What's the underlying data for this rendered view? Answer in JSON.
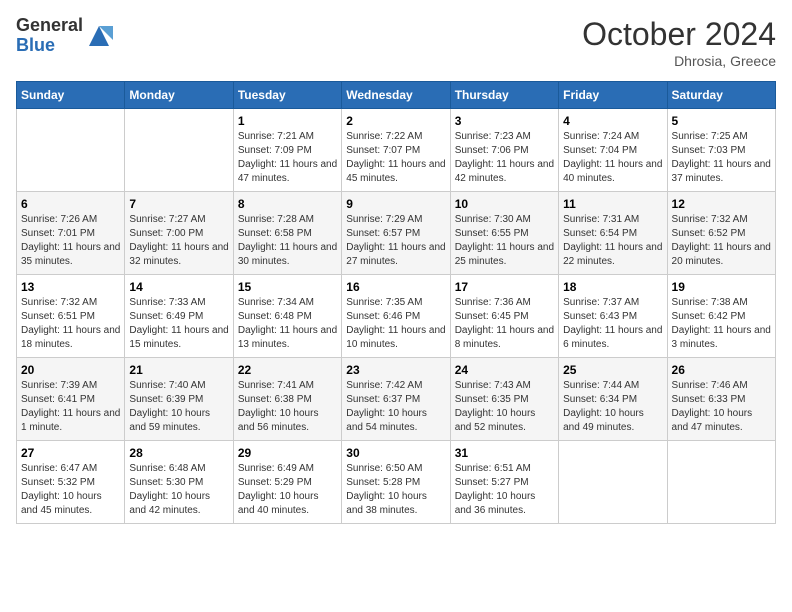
{
  "logo": {
    "general": "General",
    "blue": "Blue"
  },
  "title": "October 2024",
  "location": "Dhrosia, Greece",
  "days_of_week": [
    "Sunday",
    "Monday",
    "Tuesday",
    "Wednesday",
    "Thursday",
    "Friday",
    "Saturday"
  ],
  "weeks": [
    [
      {
        "day": null
      },
      {
        "day": null
      },
      {
        "day": "1",
        "sunrise": "7:21 AM",
        "sunset": "7:09 PM",
        "daylight": "11 hours and 47 minutes."
      },
      {
        "day": "2",
        "sunrise": "7:22 AM",
        "sunset": "7:07 PM",
        "daylight": "11 hours and 45 minutes."
      },
      {
        "day": "3",
        "sunrise": "7:23 AM",
        "sunset": "7:06 PM",
        "daylight": "11 hours and 42 minutes."
      },
      {
        "day": "4",
        "sunrise": "7:24 AM",
        "sunset": "7:04 PM",
        "daylight": "11 hours and 40 minutes."
      },
      {
        "day": "5",
        "sunrise": "7:25 AM",
        "sunset": "7:03 PM",
        "daylight": "11 hours and 37 minutes."
      }
    ],
    [
      {
        "day": "6",
        "sunrise": "7:26 AM",
        "sunset": "7:01 PM",
        "daylight": "11 hours and 35 minutes."
      },
      {
        "day": "7",
        "sunrise": "7:27 AM",
        "sunset": "7:00 PM",
        "daylight": "11 hours and 32 minutes."
      },
      {
        "day": "8",
        "sunrise": "7:28 AM",
        "sunset": "6:58 PM",
        "daylight": "11 hours and 30 minutes."
      },
      {
        "day": "9",
        "sunrise": "7:29 AM",
        "sunset": "6:57 PM",
        "daylight": "11 hours and 27 minutes."
      },
      {
        "day": "10",
        "sunrise": "7:30 AM",
        "sunset": "6:55 PM",
        "daylight": "11 hours and 25 minutes."
      },
      {
        "day": "11",
        "sunrise": "7:31 AM",
        "sunset": "6:54 PM",
        "daylight": "11 hours and 22 minutes."
      },
      {
        "day": "12",
        "sunrise": "7:32 AM",
        "sunset": "6:52 PM",
        "daylight": "11 hours and 20 minutes."
      }
    ],
    [
      {
        "day": "13",
        "sunrise": "7:32 AM",
        "sunset": "6:51 PM",
        "daylight": "11 hours and 18 minutes."
      },
      {
        "day": "14",
        "sunrise": "7:33 AM",
        "sunset": "6:49 PM",
        "daylight": "11 hours and 15 minutes."
      },
      {
        "day": "15",
        "sunrise": "7:34 AM",
        "sunset": "6:48 PM",
        "daylight": "11 hours and 13 minutes."
      },
      {
        "day": "16",
        "sunrise": "7:35 AM",
        "sunset": "6:46 PM",
        "daylight": "11 hours and 10 minutes."
      },
      {
        "day": "17",
        "sunrise": "7:36 AM",
        "sunset": "6:45 PM",
        "daylight": "11 hours and 8 minutes."
      },
      {
        "day": "18",
        "sunrise": "7:37 AM",
        "sunset": "6:43 PM",
        "daylight": "11 hours and 6 minutes."
      },
      {
        "day": "19",
        "sunrise": "7:38 AM",
        "sunset": "6:42 PM",
        "daylight": "11 hours and 3 minutes."
      }
    ],
    [
      {
        "day": "20",
        "sunrise": "7:39 AM",
        "sunset": "6:41 PM",
        "daylight": "11 hours and 1 minute."
      },
      {
        "day": "21",
        "sunrise": "7:40 AM",
        "sunset": "6:39 PM",
        "daylight": "10 hours and 59 minutes."
      },
      {
        "day": "22",
        "sunrise": "7:41 AM",
        "sunset": "6:38 PM",
        "daylight": "10 hours and 56 minutes."
      },
      {
        "day": "23",
        "sunrise": "7:42 AM",
        "sunset": "6:37 PM",
        "daylight": "10 hours and 54 minutes."
      },
      {
        "day": "24",
        "sunrise": "7:43 AM",
        "sunset": "6:35 PM",
        "daylight": "10 hours and 52 minutes."
      },
      {
        "day": "25",
        "sunrise": "7:44 AM",
        "sunset": "6:34 PM",
        "daylight": "10 hours and 49 minutes."
      },
      {
        "day": "26",
        "sunrise": "7:46 AM",
        "sunset": "6:33 PM",
        "daylight": "10 hours and 47 minutes."
      }
    ],
    [
      {
        "day": "27",
        "sunrise": "6:47 AM",
        "sunset": "5:32 PM",
        "daylight": "10 hours and 45 minutes."
      },
      {
        "day": "28",
        "sunrise": "6:48 AM",
        "sunset": "5:30 PM",
        "daylight": "10 hours and 42 minutes."
      },
      {
        "day": "29",
        "sunrise": "6:49 AM",
        "sunset": "5:29 PM",
        "daylight": "10 hours and 40 minutes."
      },
      {
        "day": "30",
        "sunrise": "6:50 AM",
        "sunset": "5:28 PM",
        "daylight": "10 hours and 38 minutes."
      },
      {
        "day": "31",
        "sunrise": "6:51 AM",
        "sunset": "5:27 PM",
        "daylight": "10 hours and 36 minutes."
      },
      {
        "day": null
      },
      {
        "day": null
      }
    ]
  ]
}
